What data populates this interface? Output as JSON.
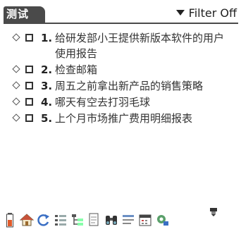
{
  "header": {
    "title": "测试",
    "filter_label": "Filter Off",
    "filter_icon": "dropdown-triangle-icon"
  },
  "tasks": [
    {
      "number": "1.",
      "text": "给研发部小王提供新版本软件的用户使用报告",
      "checked": false
    },
    {
      "number": "2.",
      "text": "检查邮箱",
      "checked": false
    },
    {
      "number": "3.",
      "text": "周五之前拿出新产品的销售策略",
      "checked": false
    },
    {
      "number": "4.",
      "text": "哪天有空去打羽毛球",
      "checked": false
    },
    {
      "number": "5.",
      "text": "上个月市场推广费用明细报表",
      "checked": false
    }
  ],
  "toolbar": {
    "icons": [
      "battery-icon",
      "home-icon",
      "refresh-icon",
      "list-view-icon",
      "tree-view-icon",
      "document-icon",
      "binoculars-icon",
      "details-icon",
      "calendar-icon",
      "settings-icon"
    ],
    "scroll_icon": "scroll-indicator-icon"
  },
  "colors": {
    "header_tab": "#4a4a4a",
    "text": "#333333"
  }
}
